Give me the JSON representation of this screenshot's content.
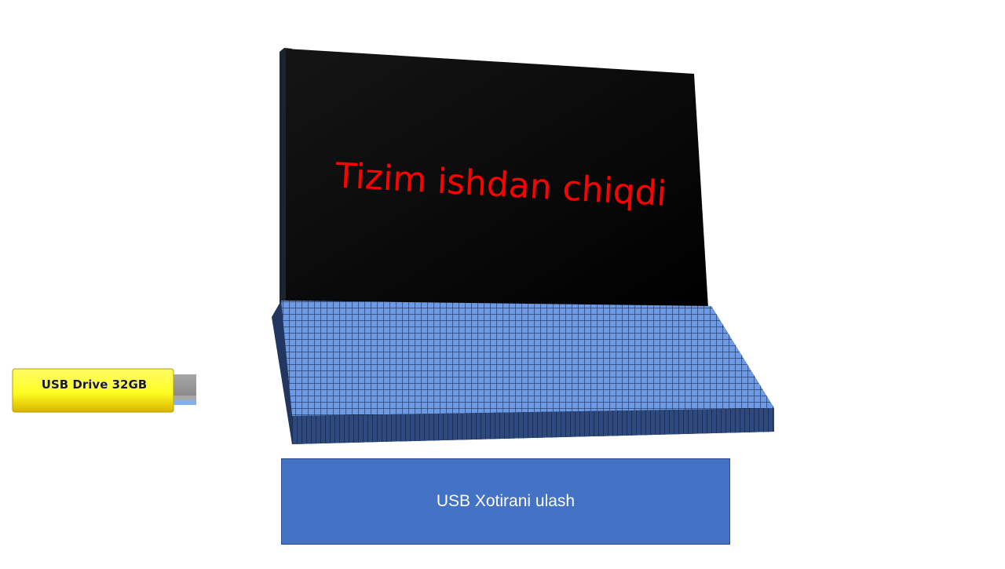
{
  "screen": {
    "message": "Tizim ishdan chiqdi",
    "message_color": "#ff0000",
    "background_color": "#000000"
  },
  "keyboard": {
    "key_color": "#6a9ae8",
    "grid_color": "#0d1a33"
  },
  "usb_drive": {
    "label": "USB Drive 32GB",
    "body_color": "#ffff33"
  },
  "action": {
    "label": "USB Xotirani ulash",
    "color": "#4472c4"
  }
}
